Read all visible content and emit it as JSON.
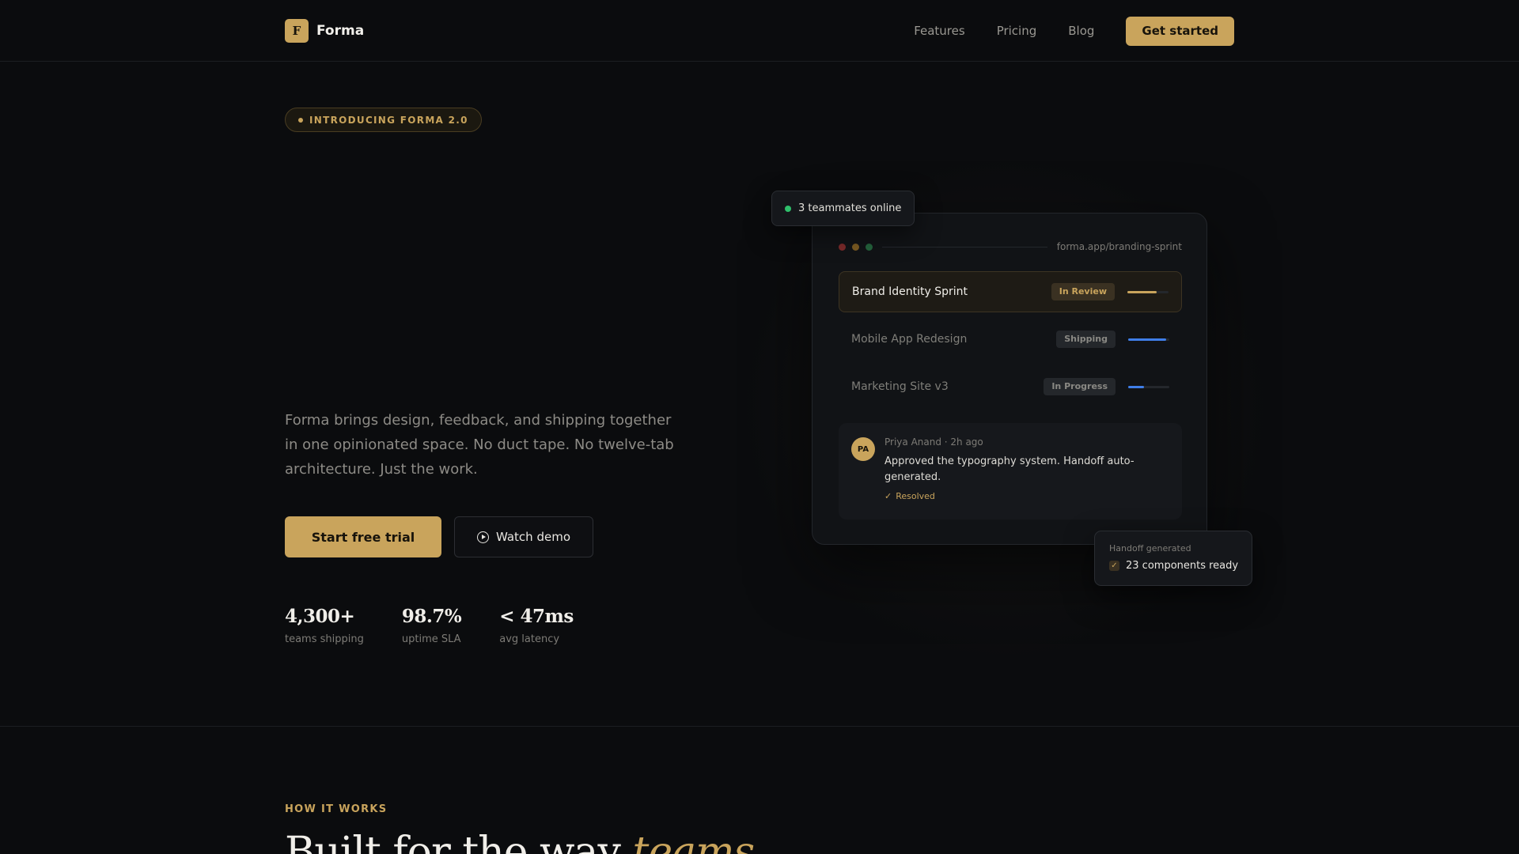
{
  "nav": {
    "logo_mark": "F",
    "logo_text": "Forma",
    "links": [
      "Features",
      "Pricing",
      "Blog"
    ],
    "cta": "Get started"
  },
  "hero": {
    "badge": "INTRODUCING FORMA 2.0",
    "description": "Forma brings design, feedback, and shipping together in one opinionated space. No duct tape. No twelve-tab architecture. Just the work.",
    "primary_button": "Start free trial",
    "secondary_button": "Watch demo",
    "stats": [
      {
        "value": "4,300+",
        "label": "teams shipping"
      },
      {
        "value": "98.7%",
        "label": "uptime SLA"
      },
      {
        "value": "< 47ms",
        "label": "avg latency"
      }
    ]
  },
  "mock": {
    "presence": "3 teammates online",
    "url": "forma.app/branding-sprint",
    "projects": [
      {
        "name": "Brand Identity Sprint",
        "status": "In Review",
        "progress": 0.72,
        "color": "#c9a45c"
      },
      {
        "name": "Mobile App Redesign",
        "status": "Shipping",
        "progress": 0.92,
        "color": "#3f7ee8"
      },
      {
        "name": "Marketing Site v3",
        "status": "In Progress",
        "progress": 0.38,
        "color": "#3f7ee8"
      }
    ],
    "comment": {
      "initials": "PA",
      "meta": "Priya Anand · 2h ago",
      "text": "Approved the typography system. Handoff auto-generated.",
      "resolved": "Resolved"
    },
    "handoff": {
      "label": "Handoff generated",
      "text": "23 components ready"
    }
  },
  "section": {
    "eyebrow": "HOW IT WORKS",
    "title_plain": "Built for the way ",
    "title_accent": "teams"
  },
  "colors": {
    "background": "#0b0c0e",
    "accent": "#c9a45c",
    "online": "#2fbf6b",
    "progress_blue": "#3f7ee8"
  }
}
